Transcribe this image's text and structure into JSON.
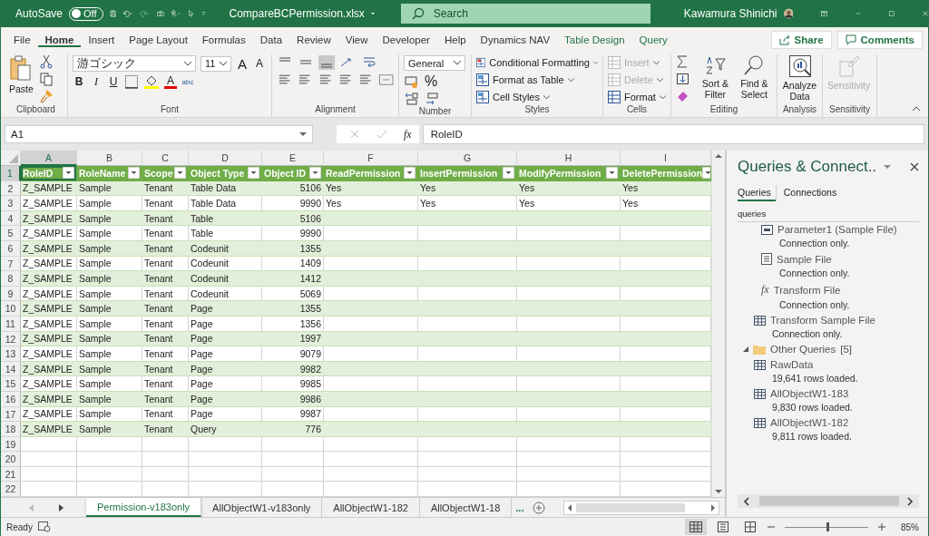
{
  "title_bar": {
    "autosave_label": "AutoSave",
    "autosave": {
      "on": false,
      "label": "Off"
    },
    "filename": "CompareBCPermission.xlsx",
    "search": {
      "placeholder": "Search"
    },
    "user": "Kawamura Shinichi"
  },
  "ribbon_tabs": [
    {
      "label": "File",
      "selected": false,
      "kind": "normal"
    },
    {
      "label": "Home",
      "selected": true,
      "kind": "normal"
    },
    {
      "label": "Insert",
      "selected": false,
      "kind": "normal"
    },
    {
      "label": "Page Layout",
      "selected": false,
      "kind": "normal"
    },
    {
      "label": "Formulas",
      "selected": false,
      "kind": "normal"
    },
    {
      "label": "Data",
      "selected": false,
      "kind": "normal"
    },
    {
      "label": "Review",
      "selected": false,
      "kind": "normal"
    },
    {
      "label": "View",
      "selected": false,
      "kind": "normal"
    },
    {
      "label": "Developer",
      "selected": false,
      "kind": "normal"
    },
    {
      "label": "Help",
      "selected": false,
      "kind": "normal"
    },
    {
      "label": "Dynamics NAV",
      "selected": false,
      "kind": "normal"
    },
    {
      "label": "Table Design",
      "selected": false,
      "kind": "contextual"
    },
    {
      "label": "Query",
      "selected": false,
      "kind": "contextual"
    }
  ],
  "share": "Share",
  "comments": "Comments",
  "ribbon": {
    "clipboard": {
      "paste": "Paste",
      "label": "Clipboard"
    },
    "font": {
      "name": "游ゴシック",
      "size": "11",
      "grow": "A",
      "shrink": "A",
      "bold": "B",
      "italic": "I",
      "underline": "U",
      "font_color": "A",
      "phonetic": "abc",
      "label": "Font"
    },
    "alignment": {
      "label": "Alignment"
    },
    "number": {
      "format": "General",
      "percent": "%",
      "label": "Number"
    },
    "styles": {
      "items": [
        "Conditional Formatting",
        "Format as Table",
        "Cell Styles"
      ],
      "label": "Styles"
    },
    "cells": {
      "items": [
        {
          "label": "Insert",
          "disabled": true
        },
        {
          "label": "Delete",
          "disabled": true
        },
        {
          "label": "Format",
          "disabled": false
        }
      ],
      "label": "Cells"
    },
    "editing": {
      "sort": "Sort & Filter",
      "find": "Find & Select",
      "label": "Editing"
    },
    "analysis": {
      "button": "Analyze Data",
      "label": "Analysis"
    },
    "sensitivity": {
      "button": "Sensitivity",
      "disabled": true,
      "label": "Sensitivity"
    }
  },
  "formula_bar": {
    "name_box": "A1",
    "function_label": "fx",
    "formula": "RoleID"
  },
  "sheet": {
    "columns": [
      {
        "label": "A",
        "selected": true,
        "kind": "text"
      },
      {
        "label": "B",
        "selected": false,
        "kind": "text"
      },
      {
        "label": "C",
        "selected": false,
        "kind": "text"
      },
      {
        "label": "D",
        "selected": false,
        "kind": "text"
      },
      {
        "label": "E",
        "selected": false,
        "kind": "number"
      },
      {
        "label": "F",
        "selected": false,
        "kind": "text"
      },
      {
        "label": "G",
        "selected": false,
        "kind": "text"
      },
      {
        "label": "H",
        "selected": false,
        "kind": "text"
      },
      {
        "label": "I",
        "selected": false,
        "kind": "text"
      }
    ],
    "rows": [
      {
        "number": "1",
        "selected": true,
        "kind": "header",
        "cells": [
          "RoleID",
          "RoleName",
          "Scope",
          "Object Type",
          "Object ID",
          "ReadPermission",
          "InsertPermission",
          "ModifyPermission",
          "DeletePermission"
        ]
      },
      {
        "number": "2",
        "selected": false,
        "kind": "data",
        "cells": [
          "Z_SAMPLE",
          "Sample",
          "Tenant",
          "Table Data",
          "5106",
          "Yes",
          "Yes",
          "Yes",
          "Yes"
        ]
      },
      {
        "number": "3",
        "selected": false,
        "kind": "data",
        "cells": [
          "Z_SAMPLE",
          "Sample",
          "Tenant",
          "Table Data",
          "9990",
          "Yes",
          "Yes",
          "Yes",
          "Yes"
        ]
      },
      {
        "number": "4",
        "selected": false,
        "kind": "data",
        "cells": [
          "Z_SAMPLE",
          "Sample",
          "Tenant",
          "Table",
          "5106"
        ]
      },
      {
        "number": "5",
        "selected": false,
        "kind": "data",
        "cells": [
          "Z_SAMPLE",
          "Sample",
          "Tenant",
          "Table",
          "9990"
        ]
      },
      {
        "number": "6",
        "selected": false,
        "kind": "data",
        "cells": [
          "Z_SAMPLE",
          "Sample",
          "Tenant",
          "Codeunit",
          "1355"
        ]
      },
      {
        "number": "7",
        "selected": false,
        "kind": "data",
        "cells": [
          "Z_SAMPLE",
          "Sample",
          "Tenant",
          "Codeunit",
          "1409"
        ]
      },
      {
        "number": "8",
        "selected": false,
        "kind": "data",
        "cells": [
          "Z_SAMPLE",
          "Sample",
          "Tenant",
          "Codeunit",
          "1412"
        ]
      },
      {
        "number": "9",
        "selected": false,
        "kind": "data",
        "cells": [
          "Z_SAMPLE",
          "Sample",
          "Tenant",
          "Codeunit",
          "5069"
        ]
      },
      {
        "number": "10",
        "selected": false,
        "kind": "data",
        "cells": [
          "Z_SAMPLE",
          "Sample",
          "Tenant",
          "Page",
          "1355"
        ]
      },
      {
        "number": "11",
        "selected": false,
        "kind": "data",
        "cells": [
          "Z_SAMPLE",
          "Sample",
          "Tenant",
          "Page",
          "1356"
        ]
      },
      {
        "number": "12",
        "selected": false,
        "kind": "data",
        "cells": [
          "Z_SAMPLE",
          "Sample",
          "Tenant",
          "Page",
          "1997"
        ]
      },
      {
        "number": "13",
        "selected": false,
        "kind": "data",
        "cells": [
          "Z_SAMPLE",
          "Sample",
          "Tenant",
          "Page",
          "9079"
        ]
      },
      {
        "number": "14",
        "selected": false,
        "kind": "data",
        "cells": [
          "Z_SAMPLE",
          "Sample",
          "Tenant",
          "Page",
          "9982"
        ]
      },
      {
        "number": "15",
        "selected": false,
        "kind": "data",
        "cells": [
          "Z_SAMPLE",
          "Sample",
          "Tenant",
          "Page",
          "9985"
        ]
      },
      {
        "number": "16",
        "selected": false,
        "kind": "data",
        "cells": [
          "Z_SAMPLE",
          "Sample",
          "Tenant",
          "Page",
          "9986"
        ]
      },
      {
        "number": "17",
        "selected": false,
        "kind": "data",
        "cells": [
          "Z_SAMPLE",
          "Sample",
          "Tenant",
          "Page",
          "9987"
        ]
      },
      {
        "number": "18",
        "selected": false,
        "kind": "data",
        "cells": [
          "Z_SAMPLE",
          "Sample",
          "Tenant",
          "Query",
          "776"
        ]
      },
      {
        "number": "19",
        "selected": false,
        "kind": "blank"
      },
      {
        "number": "20",
        "selected": false,
        "kind": "blank"
      },
      {
        "number": "21",
        "selected": false,
        "kind": "blank"
      },
      {
        "number": "22",
        "selected": false,
        "kind": "blank"
      }
    ]
  },
  "sheet_tabs": [
    {
      "label": "Permission-v183only",
      "selected": true
    },
    {
      "label": "AllObjectW1-v183only",
      "selected": false
    },
    {
      "label": "AllObjectW1-182",
      "selected": false
    },
    {
      "label": "AllObjectW1-18",
      "selected": false
    }
  ],
  "more_tabs": "...",
  "queries_pane": {
    "title": "Queries & Connect..",
    "tabs": [
      {
        "label": "Queries",
        "selected": true
      },
      {
        "label": "Connections",
        "selected": false
      }
    ],
    "count": "queries",
    "tree": [
      {
        "kind": "group",
        "children": [
          {
            "kind": "parameter",
            "name": "Parameter1 (Sample File)",
            "status": "Connection only."
          },
          {
            "kind": "list",
            "name": "Sample File",
            "status": "Connection only."
          },
          {
            "kind": "function",
            "symbol": "fx",
            "name": "Transform File",
            "status": "Connection only."
          }
        ]
      },
      {
        "kind": "table",
        "name": "Transform Sample File",
        "status": "Connection only."
      },
      {
        "kind": "folder",
        "name": "Other Queries",
        "count": "[5]",
        "expanded": true,
        "children": [
          {
            "kind": "table",
            "name": "RawData",
            "status": "19,641 rows loaded."
          },
          {
            "kind": "table",
            "name": "AllObjectW1-183",
            "status": "9,830 rows loaded."
          },
          {
            "kind": "table",
            "name": "AllObjectW1-182",
            "status": "9,811 rows loaded."
          }
        ]
      }
    ]
  },
  "status_bar": {
    "status": "Ready",
    "zoom": "85%",
    "zoom_slider": {
      "level": 0.5
    }
  }
}
